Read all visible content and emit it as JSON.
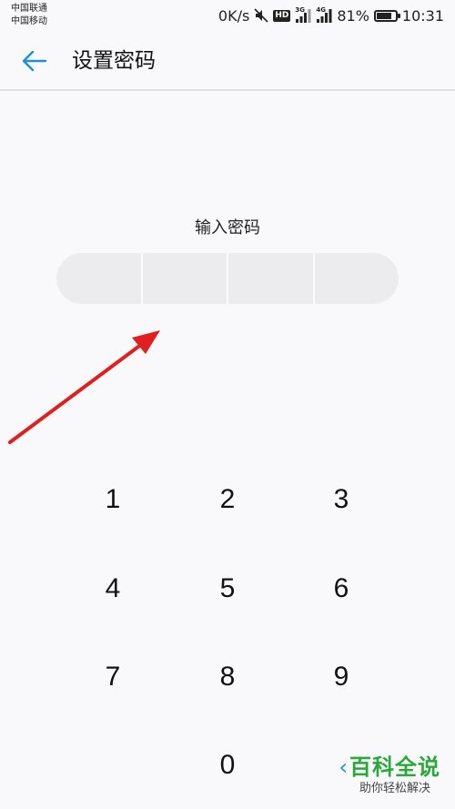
{
  "status_bar": {
    "carrier_1": "中国联通",
    "carrier_2": "中国移动",
    "net_speed": "0K/s",
    "hd_badge": "HD",
    "sim1_type": "3G",
    "sim2_type": "4G",
    "battery_percent": "81%",
    "battery_level": 0.81,
    "time": "10:31",
    "icons": [
      "mute-icon",
      "hd-icon",
      "signal-3g-icon",
      "signal-4g-icon",
      "battery-icon"
    ]
  },
  "header": {
    "back_icon": "arrow-left-icon",
    "title": "设置密码"
  },
  "pin": {
    "prompt": "输入密码",
    "cells": [
      "",
      "",
      "",
      ""
    ]
  },
  "keypad": {
    "keys": [
      "1",
      "2",
      "3",
      "4",
      "5",
      "6",
      "7",
      "8",
      "9",
      "0"
    ]
  },
  "watermark": {
    "brand": "百科全说",
    "slogan": "助你轻松解决"
  },
  "colors": {
    "accent": "#1e8fd6",
    "annotation_arrow": "#e02020",
    "watermark_brand": "#2aa83a",
    "pin_field": "#ececee"
  }
}
